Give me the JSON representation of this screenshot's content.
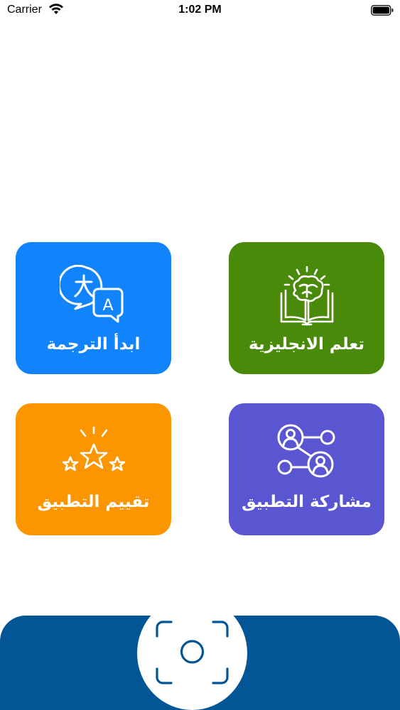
{
  "status_bar": {
    "carrier": "Carrier",
    "time": "1:02 PM"
  },
  "tiles": {
    "translate": {
      "label": "ابدأ الترجمة",
      "icon": "translate-chat-icon",
      "color": "#1183fb"
    },
    "learn": {
      "label": "تعلم الانجليزية",
      "icon": "brain-book-icon",
      "color": "#4a8a0a"
    },
    "rate": {
      "label": "تقييم التطبيق",
      "icon": "stars-rating-icon",
      "color": "#fb9500"
    },
    "share": {
      "label": "مشاركة التطبيق",
      "icon": "share-network-icon",
      "color": "#5a56d2"
    }
  },
  "bottom_bar": {
    "color": "#035696",
    "camera_icon": "camera-scan-icon"
  }
}
